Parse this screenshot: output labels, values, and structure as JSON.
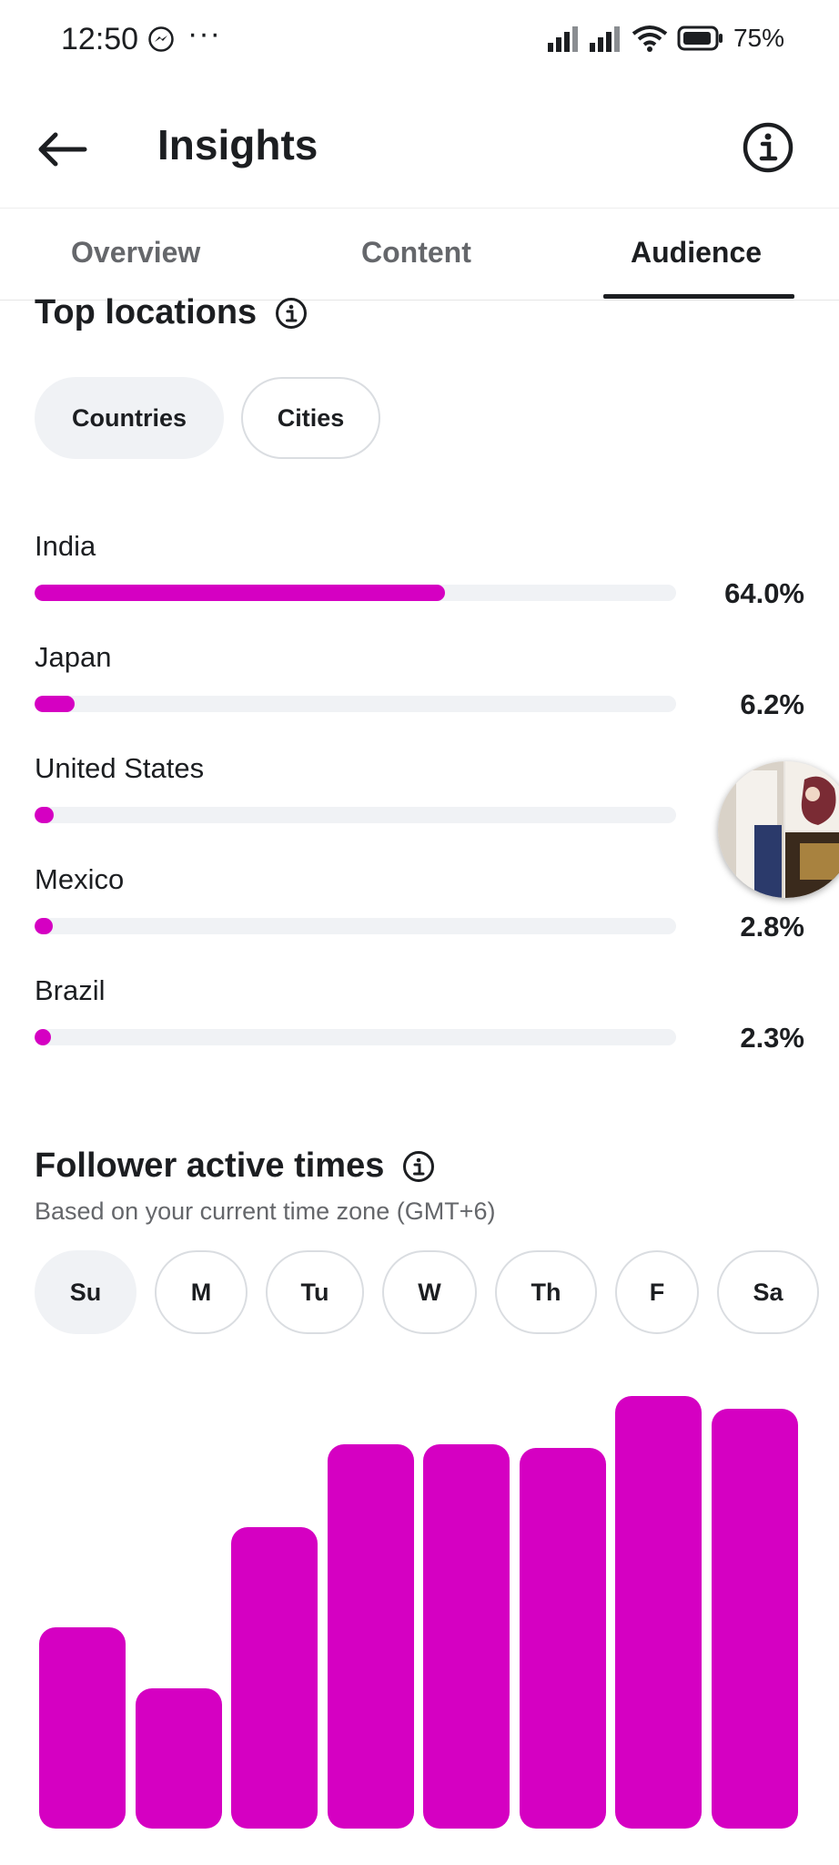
{
  "status_bar": {
    "time": "12:50",
    "more_dots": "···",
    "battery_percent": "75%"
  },
  "header": {
    "title": "Insights"
  },
  "tabs": [
    {
      "label": "Overview",
      "active": false
    },
    {
      "label": "Content",
      "active": false
    },
    {
      "label": "Audience",
      "active": true
    }
  ],
  "top_locations": {
    "title": "Top locations",
    "filters": [
      {
        "label": "Countries",
        "selected": true
      },
      {
        "label": "Cities",
        "selected": false
      }
    ],
    "rows": [
      {
        "name": "India",
        "percent_text": "64.0%",
        "fill": 0.64
      },
      {
        "name": "Japan",
        "percent_text": "6.2%",
        "fill": 0.062
      },
      {
        "name": "United States",
        "percent_text": "",
        "fill": 0.03
      },
      {
        "name": "Mexico",
        "percent_text": "2.8%",
        "fill": 0.028
      },
      {
        "name": "Brazil",
        "percent_text": "2.3%",
        "fill": 0.023
      }
    ]
  },
  "follower_active_times": {
    "title": "Follower active times",
    "subtitle": "Based on your current time zone (GMT+6)",
    "days": [
      {
        "label": "Su",
        "selected": true
      },
      {
        "label": "M",
        "selected": false
      },
      {
        "label": "Tu",
        "selected": false
      },
      {
        "label": "W",
        "selected": false
      },
      {
        "label": "Th",
        "selected": false
      },
      {
        "label": "F",
        "selected": false
      },
      {
        "label": "Sa",
        "selected": false
      }
    ]
  },
  "chart_data": {
    "type": "bar",
    "values": [
      0.46,
      0.32,
      0.69,
      0.88,
      0.88,
      0.87,
      0.99,
      0.96
    ],
    "color": "#d500c2"
  },
  "colors": {
    "accent": "#d500c2",
    "chip_selected_bg": "#f0f2f5",
    "muted_text": "#65676b"
  }
}
